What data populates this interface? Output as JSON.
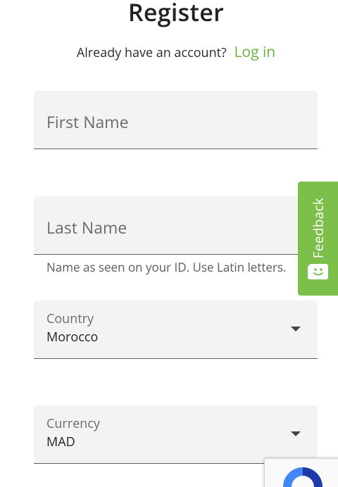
{
  "header": {
    "title": "Register",
    "account_prompt": "Already have an account?",
    "login_link": "Log in"
  },
  "form": {
    "first_name": {
      "placeholder": "First Name",
      "value": ""
    },
    "last_name": {
      "placeholder": "Last Name",
      "value": "",
      "helper": "Name as seen on your ID. Use Latin letters."
    },
    "country": {
      "label": "Country",
      "value": "Morocco"
    },
    "currency": {
      "label": "Currency",
      "value": "MAD"
    }
  },
  "feedback": {
    "label": "Feedback"
  },
  "colors": {
    "accent_green": "#6cb33f",
    "feedback_green": "#7cbf4a",
    "field_bg": "#f3f3f3"
  },
  "icons": {
    "feedback": "chat-smile-icon",
    "dropdown": "caret-down-icon",
    "recaptcha": "recaptcha-logo-icon"
  }
}
